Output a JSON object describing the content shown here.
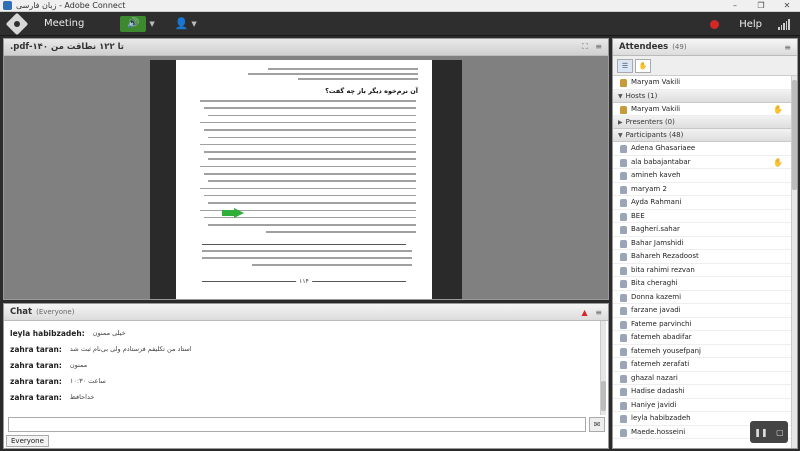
{
  "window": {
    "title": "زبان فارسی - Adobe Connect"
  },
  "menubar": {
    "meeting_label": "Meeting",
    "help_label": "Help"
  },
  "share_pod": {
    "title": ".pdf-۱۴۰ تا ۱۲۲ نطاقت من"
  },
  "document": {
    "heading": "آن نرم‌خوه دیگر باز چه گفت؟",
    "page_number": "۱۱۴"
  },
  "chat_pod": {
    "title": "Chat",
    "scope": "(Everyone)",
    "messages": [
      {
        "sender": "leyla habibzadeh:",
        "text": "خیلی ممنون"
      },
      {
        "sender": "zahra taran:",
        "text": "استاد من تکلیفم فرستادم ولی بی‌نام ثبت شد"
      },
      {
        "sender": "zahra taran:",
        "text": "ممنون"
      },
      {
        "sender": "zahra taran:",
        "text": "۱۰:۳۰ ساعت"
      },
      {
        "sender": "zahra taran:",
        "text": "خداحافظ"
      }
    ],
    "tab_label": "Everyone"
  },
  "attendees_pod": {
    "title": "Attendees",
    "count": "(49)",
    "current_user": "Maryam Vakili",
    "hosts_label": "Hosts (1)",
    "hosts": [
      "Maryam Vakili"
    ],
    "presenters_label": "Presenters (0)",
    "participants_label": "Participants (48)",
    "participants": [
      "Adena Ghasariaee",
      "ala babajantabar",
      "amineh kaveh",
      "maryam 2",
      "Ayda Rahmani",
      "BEE",
      "Bagheri.sahar",
      "Bahar Jamshidi",
      "Bahareh Rezadoost",
      "bita rahimi rezvan",
      "Bita cheraghi",
      "Donna kazemi",
      "farzane javadi",
      "Fateme parvinchi",
      "fatemeh abadifar",
      "fatemeh yousefpanj",
      "fatemeh zerafati",
      "ghazal nazari",
      "Hadise dadashi",
      "Haniye javidi",
      "leyla habibzadeh",
      "Maede.hosseini"
    ]
  },
  "colors": {
    "mic_active": "#3d8a2e",
    "record": "#d42828",
    "arrow": "#2fae3a"
  },
  "icons": [
    "app-icon",
    "connect-logo",
    "microphone-icon",
    "camera-icon",
    "record-icon",
    "signal-icon",
    "person-icon",
    "raised-hand-icon",
    "send-icon",
    "options-icon"
  ]
}
